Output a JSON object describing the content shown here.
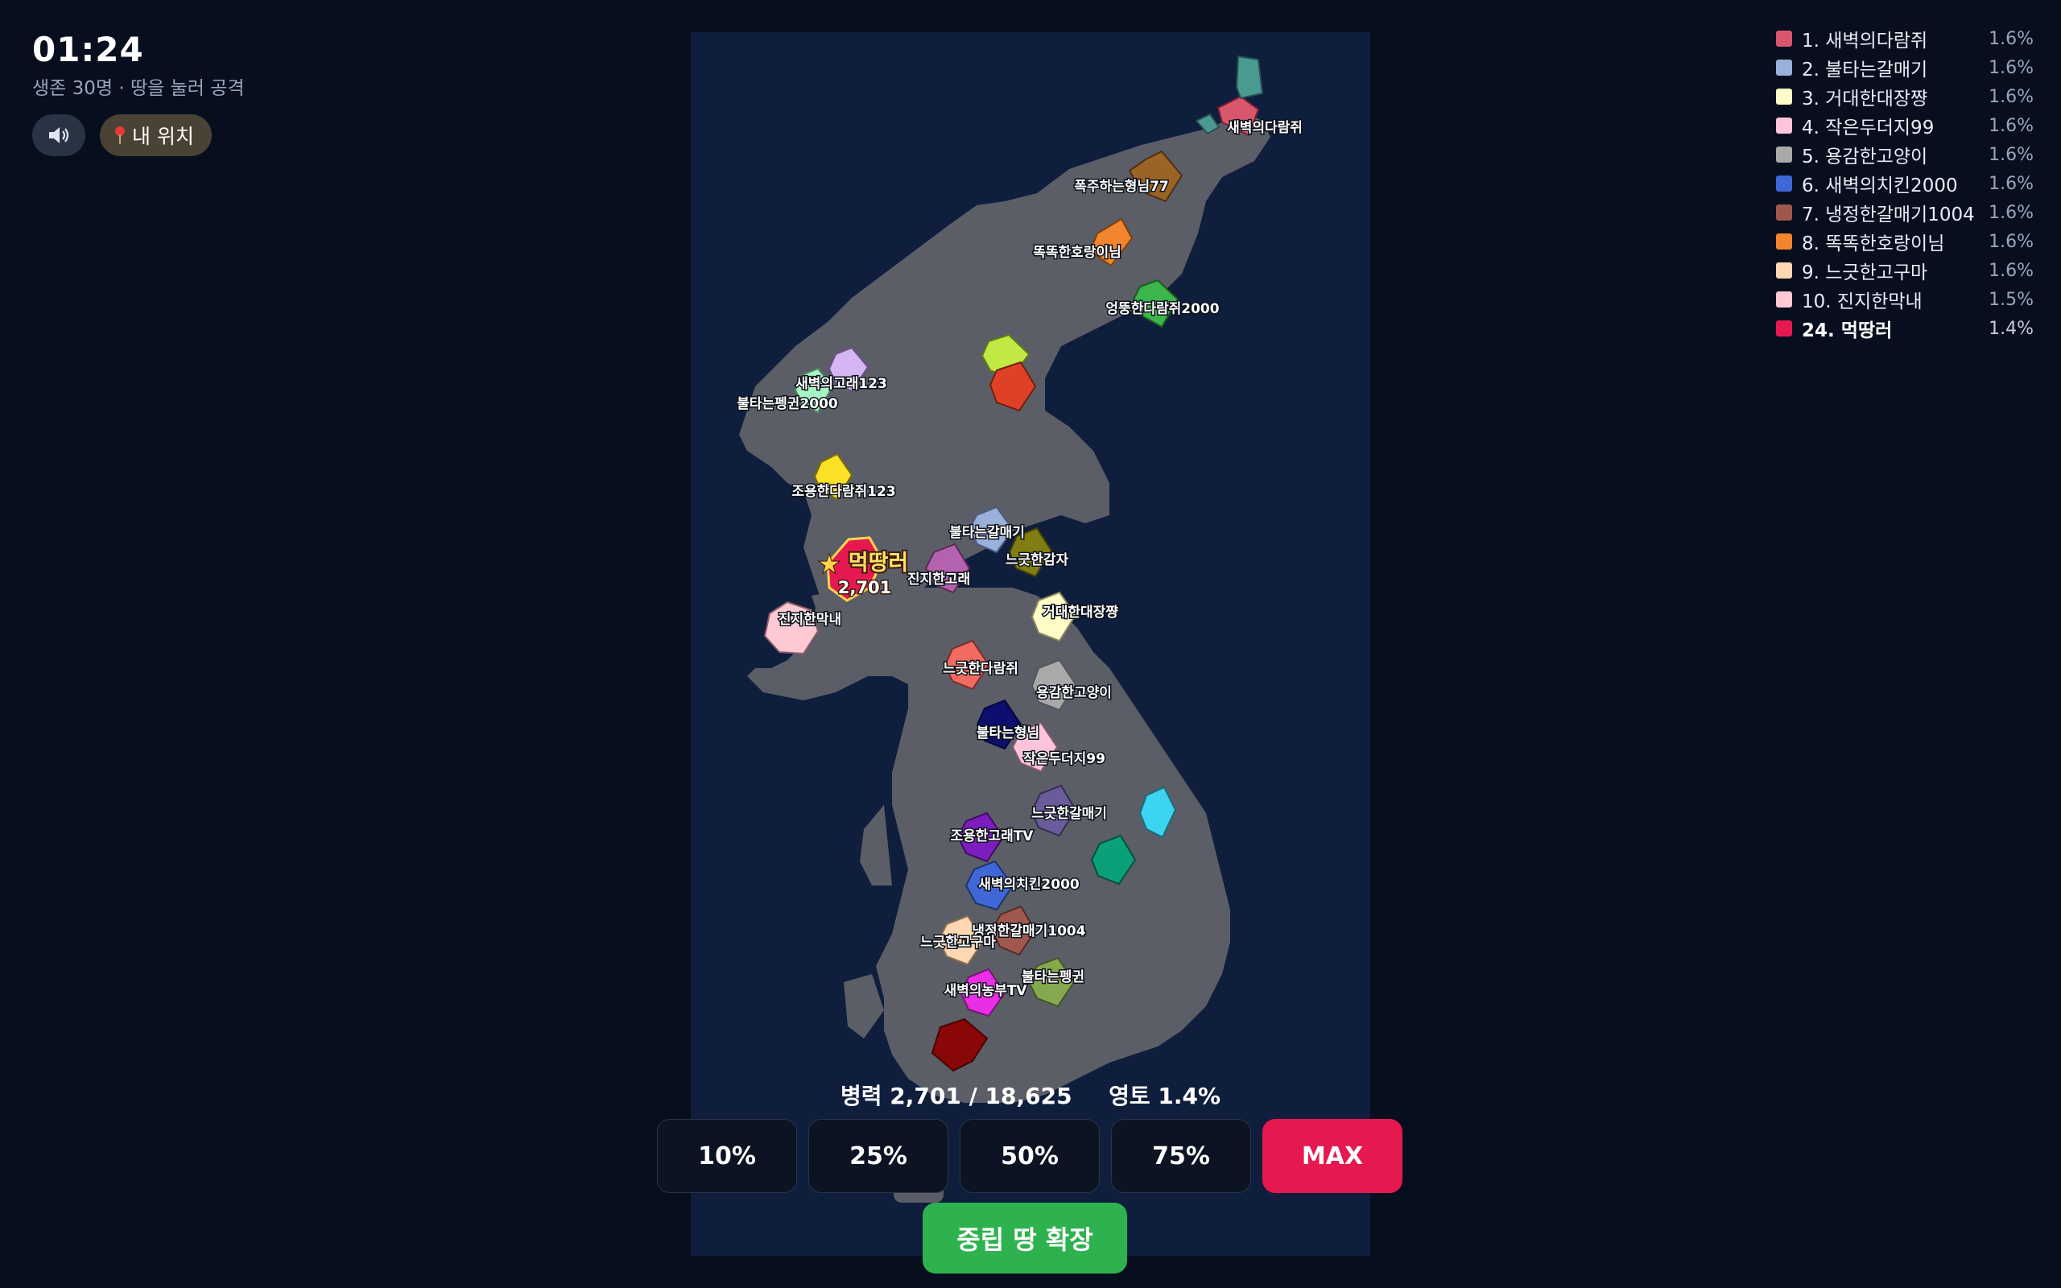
{
  "hud": {
    "timer": "01:24",
    "subtitle": "생존 30명 · 땅을 눌러 공격",
    "sound_icon": "speaker-icon",
    "locate_icon": "pin-icon",
    "locate_label": "내 위치"
  },
  "leaderboard": [
    {
      "rank_name": "1. 새벽의다람쥐",
      "pct": "1.6%",
      "color": "#d9566f"
    },
    {
      "rank_name": "2. 불타는갈매기",
      "pct": "1.6%",
      "color": "#9ab0db"
    },
    {
      "rank_name": "3. 거대한대장쨩",
      "pct": "1.6%",
      "color": "#fffcc8"
    },
    {
      "rank_name": "4. 작은두더지99",
      "pct": "1.6%",
      "color": "#ffc4dc"
    },
    {
      "rank_name": "5. 용감한고양이",
      "pct": "1.6%",
      "color": "#a9a9a9"
    },
    {
      "rank_name": "6. 새벽의치킨2000",
      "pct": "1.6%",
      "color": "#3f67d6"
    },
    {
      "rank_name": "7. 냉정한갈매기1004",
      "pct": "1.6%",
      "color": "#a0584e"
    },
    {
      "rank_name": "8. 똑똑한호랑이님",
      "pct": "1.6%",
      "color": "#f2852e"
    },
    {
      "rank_name": "9. 느긋한고구마",
      "pct": "1.6%",
      "color": "#ffd7b0"
    },
    {
      "rank_name": "10. 진지한막내",
      "pct": "1.5%",
      "color": "#ffc9d3"
    },
    {
      "rank_name": "24. 먹땅러",
      "pct": "1.4%",
      "color": "#e5194f",
      "me": true
    }
  ],
  "map": {
    "neutral_color": "#5b5e66",
    "sea_color": "#0f1e3d",
    "player": {
      "name": "먹땅러",
      "troops": "2,701",
      "color": "#e5194f"
    },
    "territories": [
      {
        "name": "새벽의다람쥐",
        "color": "#d9566f"
      },
      {
        "name": "",
        "color": "#4a9a92"
      },
      {
        "name": "폭주하는형님77",
        "color": "#9a6427"
      },
      {
        "name": "똑똑한호랑이님",
        "color": "#f2852e"
      },
      {
        "name": "엉뚱한다람쥐2000",
        "color": "#3cb54a"
      },
      {
        "name": "",
        "color": "#c2e843"
      },
      {
        "name": "",
        "color": "#df4127"
      },
      {
        "name": "새벽의고래123",
        "color": "#d4b6f2"
      },
      {
        "name": "불타는펭귄2000",
        "color": "#a7f5c4"
      },
      {
        "name": "조용한다람쥐123",
        "color": "#fde127"
      },
      {
        "name": "불타는갈매기",
        "color": "#9ab0db"
      },
      {
        "name": "느긋한감자",
        "color": "#7f7d13"
      },
      {
        "name": "진지한고래",
        "color": "#b461b0"
      },
      {
        "name": "진지한막내",
        "color": "#ffc9d3"
      },
      {
        "name": "거대한대장쨩",
        "color": "#fffcc8"
      },
      {
        "name": "느긋한다람쥐",
        "color": "#f26b61"
      },
      {
        "name": "용감한고양이",
        "color": "#a9a9a9"
      },
      {
        "name": "불타는형님",
        "color": "#0c0f6e"
      },
      {
        "name": "작은두더지99",
        "color": "#ffc4dc"
      },
      {
        "name": "느긋한갈매기",
        "color": "#6a5c9a"
      },
      {
        "name": "",
        "color": "#3cd4f1"
      },
      {
        "name": "조용한고래TV",
        "color": "#7d1dbd"
      },
      {
        "name": "",
        "color": "#0aa07a"
      },
      {
        "name": "새벽의치킨2000",
        "color": "#3f67d6"
      },
      {
        "name": "냉정한갈매기1004",
        "color": "#a0584e"
      },
      {
        "name": "느긋한고구마",
        "color": "#ffd7b0"
      },
      {
        "name": "불타는펭귄",
        "color": "#86a84f"
      },
      {
        "name": "새벽의농부TV",
        "color": "#ea2ee6"
      },
      {
        "name": "",
        "color": "#8a0707"
      }
    ]
  },
  "status": {
    "troops_label": "병력",
    "troops_value": "2,701 / 18,625",
    "land_label": "영토",
    "land_value": "1.4%"
  },
  "controls": {
    "pct_buttons": [
      "10%",
      "25%",
      "50%",
      "75%",
      "MAX"
    ],
    "expand_label": "중립 땅 확장"
  }
}
